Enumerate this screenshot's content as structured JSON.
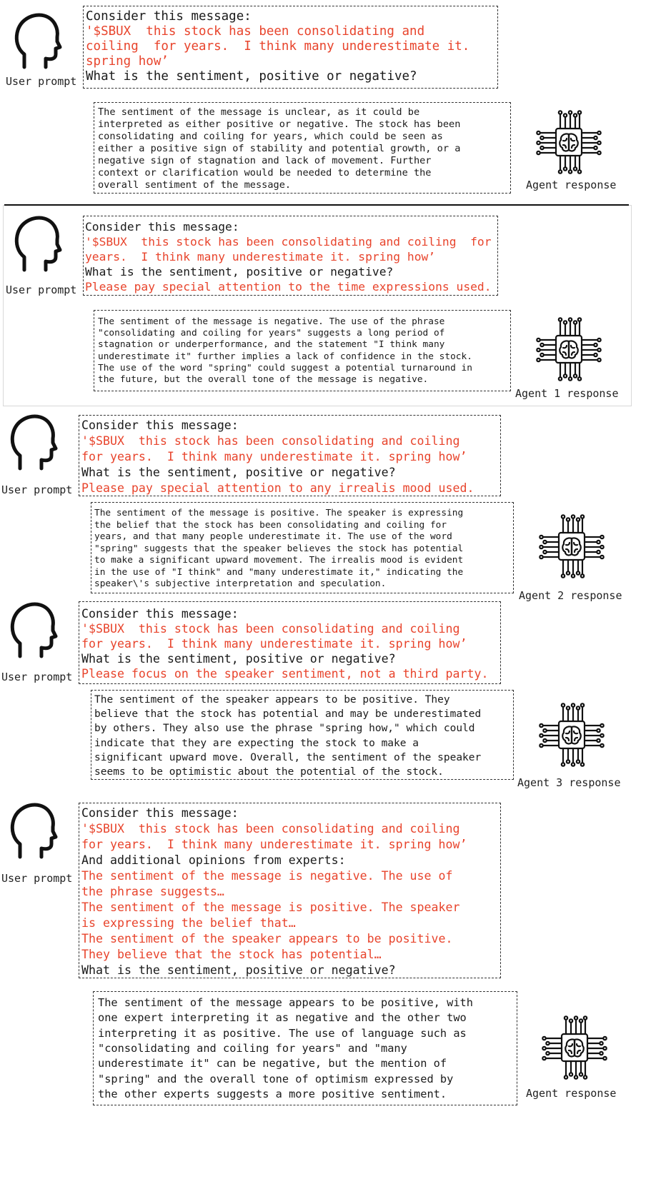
{
  "labels": {
    "user_prompt": "User prompt",
    "agent_response": "Agent response",
    "agent1_response": "Agent 1 response",
    "agent2_response": "Agent 2 response",
    "agent3_response": "Agent 3 response"
  },
  "panel1": {
    "prompt": [
      {
        "text": "Consider this message:",
        "red": false
      },
      {
        "text": "'$SBUX  this stock has been consolidating and",
        "red": true
      },
      {
        "text": "coiling  for years.  I think many underestimate it.",
        "red": true
      },
      {
        "text": "spring how’",
        "red": true
      },
      {
        "text": "What is the sentiment, positive or negative?",
        "red": false
      }
    ],
    "response": [
      "The sentiment of the message is unclear, as it could be",
      "interpreted as either positive or negative. The stock has been",
      "consolidating and coiling for years, which could be seen as",
      "either a positive sign of stability and potential growth, or a",
      "negative sign of stagnation and lack of movement. Further",
      "context or clarification would be needed to determine the",
      "overall sentiment of the message."
    ]
  },
  "panel2": {
    "prompt": [
      {
        "text": "Consider this message:",
        "red": false
      },
      {
        "text": "'$SBUX  this stock has been consolidating and coiling  for",
        "red": true
      },
      {
        "text": "years.  I think many underestimate it. spring how’",
        "red": true
      },
      {
        "text": "What is the sentiment, positive or negative?",
        "red": false
      },
      {
        "text": "Please pay special attention to the time expressions used.",
        "red": true
      }
    ],
    "response": [
      "The sentiment of the message is negative. The use of the phrase",
      "\"consolidating and coiling for years\" suggests a long period of",
      "stagnation or underperformance, and the statement \"I think many",
      "underestimate it\" further implies a lack of confidence in the stock.",
      "The use of the word \"spring\" could suggest a potential turnaround in",
      "the future, but the overall tone of the message is negative."
    ]
  },
  "panel3": {
    "prompt": [
      {
        "text": "Consider this message:",
        "red": false
      },
      {
        "text": "'$SBUX  this stock has been consolidating and coiling",
        "red": true
      },
      {
        "text": "for years.  I think many underestimate it. spring how’",
        "red": true
      },
      {
        "text": "What is the sentiment, positive or negative?",
        "red": false
      },
      {
        "text": "Please pay special attention to any irrealis mood used.",
        "red": true
      }
    ],
    "response": [
      "The sentiment of the message is positive. The speaker is expressing",
      "the belief that the stock has been consolidating and coiling for",
      "years, and that many people underestimate it. The use of the word",
      "\"spring\" suggests that the speaker believes the stock has potential",
      "to make a significant upward movement. The irrealis mood is evident",
      "in the use of \"I think\" and \"many underestimate it,\" indicating the",
      "speaker\\'s subjective interpretation and speculation."
    ]
  },
  "panel4": {
    "prompt": [
      {
        "text": "Consider this message:",
        "red": false
      },
      {
        "text": "'$SBUX  this stock has been consolidating and coiling",
        "red": true
      },
      {
        "text": "for years.  I think many underestimate it. spring how’",
        "red": true
      },
      {
        "text": "What is the sentiment, positive or negative?",
        "red": false
      },
      {
        "text": "Please focus on the speaker sentiment, not a third party.",
        "red": true
      }
    ],
    "response": [
      "The sentiment of the speaker appears to be positive. They",
      "believe that the stock has potential and may be underestimated",
      "by others. They also use the phrase \"spring how,\" which could",
      "indicate that they are expecting the stock to make a",
      "significant upward move. Overall, the sentiment of the speaker",
      "seems to be optimistic about the potential of the stock."
    ]
  },
  "panel5": {
    "prompt": [
      {
        "text": "Consider this message:",
        "red": false
      },
      {
        "text": "'$SBUX  this stock has been consolidating and coiling",
        "red": true
      },
      {
        "text": "for years.  I think many underestimate it. spring how’",
        "red": true
      },
      {
        "text": "And additional opinions from experts:",
        "red": false
      },
      {
        "text": "The sentiment of the message is negative. The use of",
        "red": true
      },
      {
        "text": "the phrase suggests…",
        "red": true
      },
      {
        "text": "The sentiment of the message is positive. The speaker",
        "red": true
      },
      {
        "text": "is expressing the belief that…",
        "red": true
      },
      {
        "text": "The sentiment of the speaker appears to be positive.",
        "red": true
      },
      {
        "text": "They believe that the stock has potential…",
        "red": true
      },
      {
        "text": "What is the sentiment, positive or negative?",
        "red": false
      }
    ],
    "response": [
      "The sentiment of the message appears to be positive, with",
      "one expert interpreting it as negative and the other two",
      "interpreting it as positive. The use of language such as",
      "\"consolidating and coiling for years\" and \"many",
      "underestimate it\" can be negative, but the mention of",
      "\"spring\" and the overall tone of optimism expressed by",
      "the other experts suggests a more positive sentiment."
    ]
  }
}
